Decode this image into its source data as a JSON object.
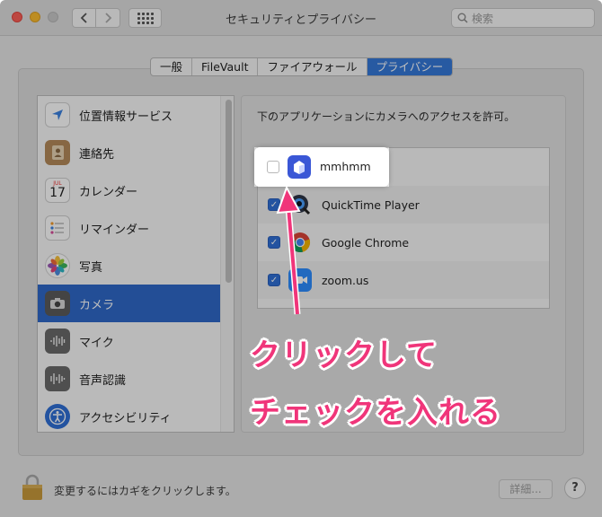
{
  "window": {
    "title": "セキュリティとプライバシー",
    "search_placeholder": "検索"
  },
  "tabs": [
    {
      "label": "一般",
      "active": false
    },
    {
      "label": "FileVault",
      "active": false
    },
    {
      "label": "ファイアウォール",
      "active": false
    },
    {
      "label": "プライバシー",
      "active": true
    }
  ],
  "sidebar": {
    "items": [
      {
        "label": "位置情報サービス",
        "icon": "location-arrow-icon",
        "selected": false
      },
      {
        "label": "連絡先",
        "icon": "contacts-book-icon",
        "selected": false
      },
      {
        "label": "カレンダー",
        "icon": "calendar-icon",
        "selected": false,
        "calendar_day": "17",
        "calendar_month": "JUL"
      },
      {
        "label": "リマインダー",
        "icon": "reminders-icon",
        "selected": false
      },
      {
        "label": "写真",
        "icon": "photos-icon",
        "selected": false
      },
      {
        "label": "カメラ",
        "icon": "camera-icon",
        "selected": true
      },
      {
        "label": "マイク",
        "icon": "microphone-icon",
        "selected": false
      },
      {
        "label": "音声認識",
        "icon": "speech-recognition-icon",
        "selected": false
      },
      {
        "label": "アクセシビリティ",
        "icon": "accessibility-icon",
        "selected": false
      }
    ]
  },
  "pane": {
    "description": "下のアプリケーションにカメラへのアクセスを許可。",
    "apps": [
      {
        "name": "mmhmm",
        "checked": false,
        "icon": "mmhmm-app-icon"
      },
      {
        "name": "QuickTime Player",
        "checked": true,
        "icon": "quicktime-icon"
      },
      {
        "name": "Google Chrome",
        "checked": true,
        "icon": "chrome-icon"
      },
      {
        "name": "zoom.us",
        "checked": true,
        "icon": "zoom-icon"
      }
    ]
  },
  "annotation": {
    "line1": "クリックして",
    "line2": "チェックを入れる",
    "color": "#f0357a"
  },
  "footer": {
    "lock_text": "変更するにはカギをクリックします。",
    "advanced_label": "詳細...",
    "help_label": "?"
  },
  "colors": {
    "accent": "#2f68c9",
    "tab_active": "#3478d8",
    "checkbox_on": "#2f6fd6"
  }
}
